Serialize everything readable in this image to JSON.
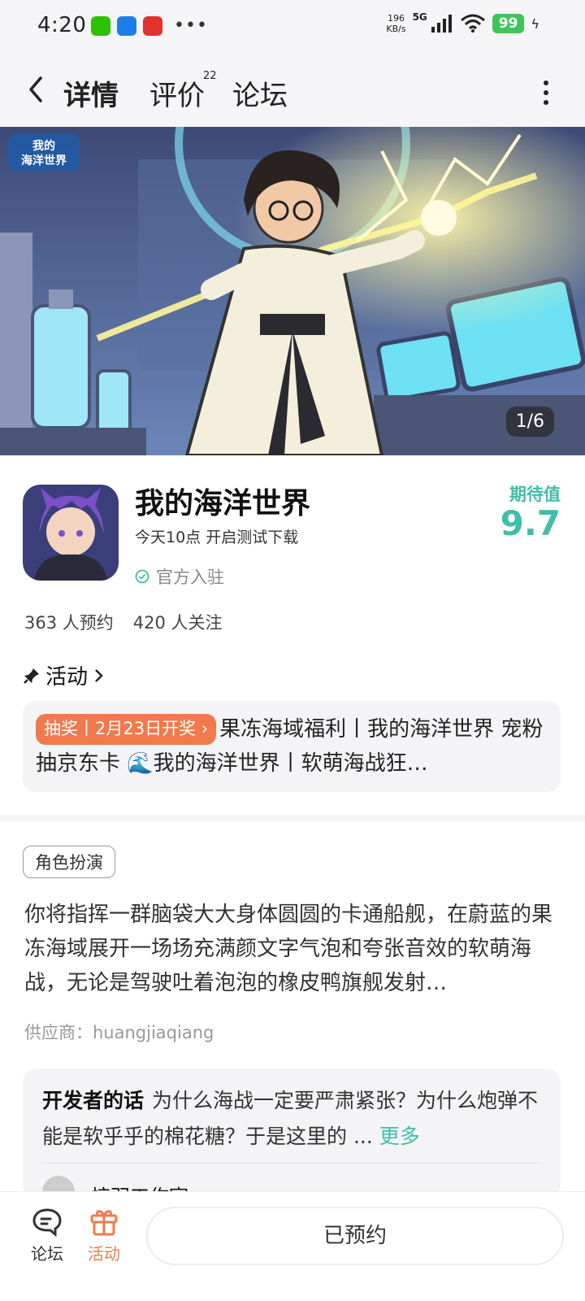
{
  "status_bar": {
    "time": "4:20",
    "network_speed_value": "196",
    "network_speed_unit": "KB/s",
    "network_type": "5G",
    "battery": "99"
  },
  "header": {
    "tabs": [
      {
        "label": "详情",
        "active": true
      },
      {
        "label": "评价",
        "badge": "22"
      },
      {
        "label": "论坛"
      }
    ]
  },
  "banner": {
    "logo_text": "我的海洋世界",
    "counter": "1/6"
  },
  "game": {
    "title": "我的海洋世界",
    "subtitle": "今天10点 开启测试下载",
    "official": "官方入驻",
    "expect_label": "期待值",
    "expect_value": "9.7",
    "stats": {
      "reservations": "363 人预约",
      "followers": "420 人关注"
    }
  },
  "activity": {
    "heading": "活动",
    "tag": "抽奖丨2月23日开奖",
    "text": "果冻海域福利丨我的海洋世界 宠粉抽京东卡 🌊我的海洋世界丨软萌海战狂…"
  },
  "description": {
    "genre": "角色扮演",
    "text": "你将指挥一群脑袋大大身体圆圆的卡通船舰，在蔚蓝的果冻海域展开一场场充满颜文字气泡和夸张音效的软萌海战，无论是驾驶吐着泡泡的橡皮鸭旗舰发射…",
    "supplier": "供应商：huangjiaqiang"
  },
  "developer": {
    "label": "开发者的话",
    "text": "为什么海战一定要严肃紧张？为什么炮弹不能是软乎乎的棉花糖？于是这里的 ...",
    "more": "更多",
    "studio": "惊羽工作室"
  },
  "bottom_bar": {
    "forum": "论坛",
    "activity": "活动",
    "reserve": "已预约"
  },
  "colors": {
    "accent": "#3fbfa8",
    "orange": "#f07a4c",
    "battery": "#3ec55a"
  }
}
